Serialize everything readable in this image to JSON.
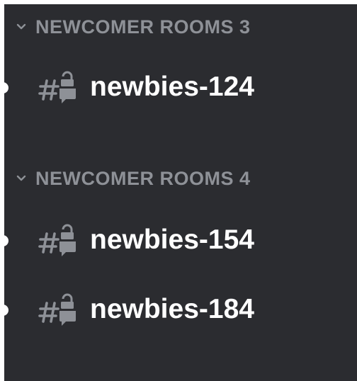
{
  "colors": {
    "panel_background": "#2b2c30",
    "category_text": "#8e9197",
    "channel_text": "#ffffff",
    "icon": "#8e9197",
    "unread_indicator": "#ffffff"
  },
  "categories": [
    {
      "label": "NEWCOMER ROOMS 3",
      "icon": "chevron-down-icon",
      "channels": [
        {
          "name": "newbies-124",
          "icon": "locked-text-channel-icon",
          "unread": true
        }
      ]
    },
    {
      "label": "NEWCOMER ROOMS 4",
      "icon": "chevron-down-icon",
      "channels": [
        {
          "name": "newbies-154",
          "icon": "locked-text-channel-icon",
          "unread": true
        },
        {
          "name": "newbies-184",
          "icon": "locked-text-channel-icon",
          "unread": true
        }
      ]
    }
  ]
}
